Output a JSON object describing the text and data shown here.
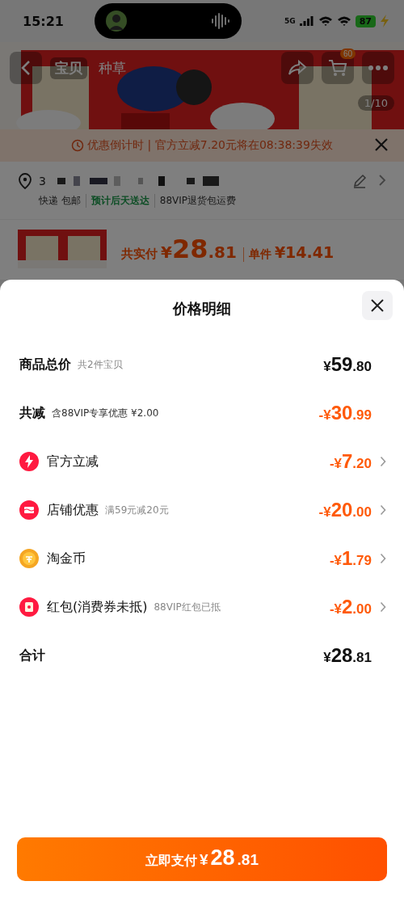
{
  "status_bar": {
    "time": "15:21",
    "network": "5G",
    "battery": "87"
  },
  "header": {
    "tabs": [
      {
        "label": "宝贝",
        "selected": true
      },
      {
        "label": "种草",
        "selected": false
      }
    ],
    "cart_count": "60",
    "photo_counter": "1/10"
  },
  "countdown_banner": {
    "text": "优惠倒计时 | 官方立减7.20元将在08:38:39失效"
  },
  "address": {
    "text": "3"
  },
  "delivery": [
    "快递 包邮",
    "预计后天送达",
    "88VIP退货包运费"
  ],
  "order_price": {
    "label": "共实付",
    "currency": "¥",
    "integer": "28",
    "decimal": ".81",
    "unit_label": "单件",
    "unit_price": "¥14.41"
  },
  "sheet": {
    "title": "价格明细",
    "rows": [
      {
        "kind": "total",
        "label": "商品总价",
        "note": "共2件宝贝",
        "prefix": "¥",
        "integer": "59",
        "decimal": ".80"
      },
      {
        "kind": "saving",
        "label": "共减",
        "note": "含88VIP专享优惠 ¥2.00",
        "prefix": "-¥",
        "integer": "30",
        "decimal": ".99"
      },
      {
        "kind": "discount",
        "label": "官方立减",
        "prefix": "-¥",
        "integer": "7",
        "decimal": ".20"
      },
      {
        "kind": "discount",
        "label": "店铺优惠",
        "note": "满59元减20元",
        "prefix": "-¥",
        "integer": "20",
        "decimal": ".00"
      },
      {
        "kind": "discount",
        "label": "淘金币",
        "prefix": "-¥",
        "integer": "1",
        "decimal": ".79"
      },
      {
        "kind": "discount",
        "label": "红包(消费券未抵)",
        "note": "88VIP红包已抵",
        "prefix": "-¥",
        "integer": "2",
        "decimal": ".00"
      },
      {
        "kind": "total",
        "label": "合计",
        "prefix": "¥",
        "integer": "28",
        "decimal": ".81"
      }
    ]
  },
  "pay_button": {
    "label": "立即支付",
    "currency": "¥",
    "integer": "28",
    "decimal": ".81"
  }
}
